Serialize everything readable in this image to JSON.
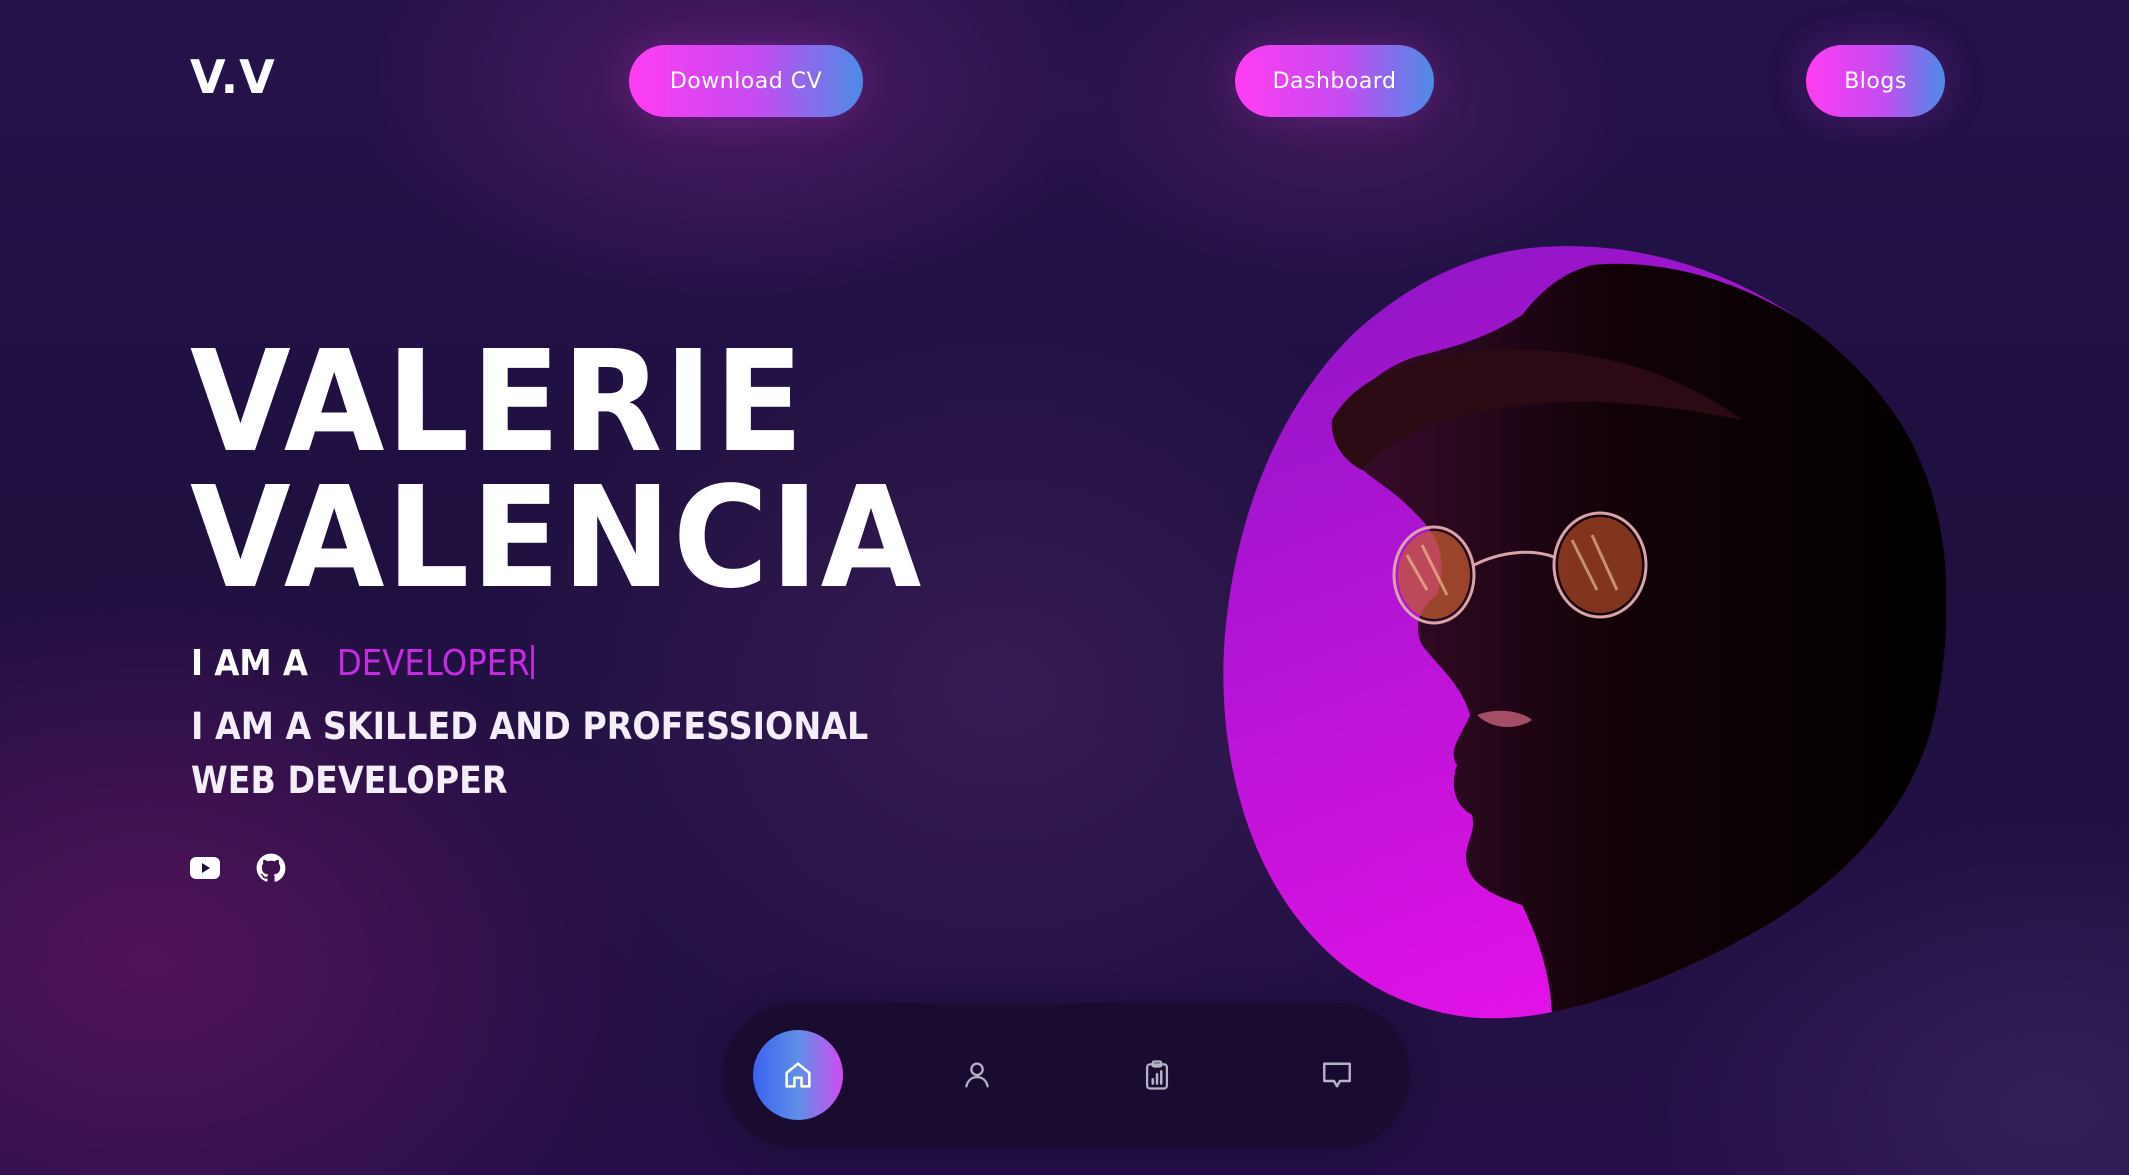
{
  "header": {
    "logo": "V.V",
    "buttons": {
      "download_cv": "Download CV",
      "dashboard": "Dashboard",
      "blogs": "Blogs"
    },
    "accent_gradient": [
      "#ff3cf2",
      "#c44cf1",
      "#4d8ce6"
    ]
  },
  "hero": {
    "name_line1": "VALERIE",
    "name_line2": "VALENCIA",
    "role_prefix": "I AM A",
    "role_typed": "DEVELOPER",
    "tagline": "I AM A SKILLED AND PROFESSIONAL WEB DEVELOPER",
    "accent_color": "#c52be0"
  },
  "socials": [
    {
      "icon": "youtube-icon"
    },
    {
      "icon": "github-icon"
    }
  ],
  "portrait": {
    "blob_gradient": [
      "#8a16c4",
      "#e012e6"
    ]
  },
  "bottom_nav": {
    "items": [
      {
        "icon": "home-icon",
        "active": true
      },
      {
        "icon": "user-icon",
        "active": false
      },
      {
        "icon": "clipboard-chart-icon",
        "active": false
      },
      {
        "icon": "chat-icon",
        "active": false
      }
    ],
    "active_gradient": [
      "#3b63f0",
      "#5f8fe8",
      "#d04cf0"
    ]
  }
}
